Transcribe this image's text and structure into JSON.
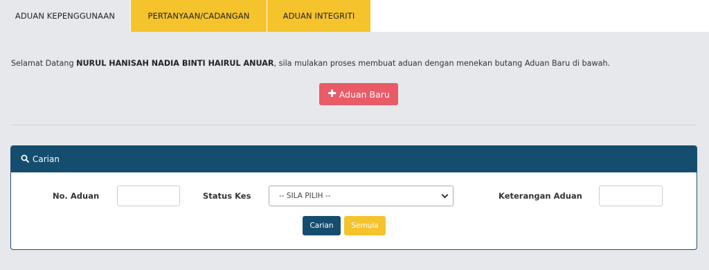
{
  "tabs": [
    {
      "label": "ADUAN KEPENGGUNAAN"
    },
    {
      "label": "PERTANYAAN/CADANGAN"
    },
    {
      "label": "ADUAN INTEGRITI"
    }
  ],
  "welcome": {
    "prefix": "Selamat Datang ",
    "name": "NURUL HANISAH NADIA BINTI HAIRUL ANUAR",
    "suffix": ", sila mulakan proses membuat aduan dengan menekan butang Aduan Baru di bawah."
  },
  "new_button": {
    "icon": "plus-icon",
    "label": "Aduan Baru"
  },
  "search_panel": {
    "title": "Carian",
    "icon": "search-icon",
    "fields": {
      "no_aduan": {
        "label": "No. Aduan",
        "value": ""
      },
      "status_kes": {
        "label": "Status Kes",
        "selected": "-- SILA PILIH --"
      },
      "keterangan": {
        "label": "Keterangan Aduan",
        "value": ""
      }
    },
    "buttons": {
      "search": "Carian",
      "reset": "Semula"
    }
  },
  "colors": {
    "tab_active_bg": "#e6e8eb",
    "tab_bg": "#f5c32c",
    "primary_dark": "#144d6e",
    "new_button": "#ea5b68",
    "reset_button": "#f5c32c"
  }
}
